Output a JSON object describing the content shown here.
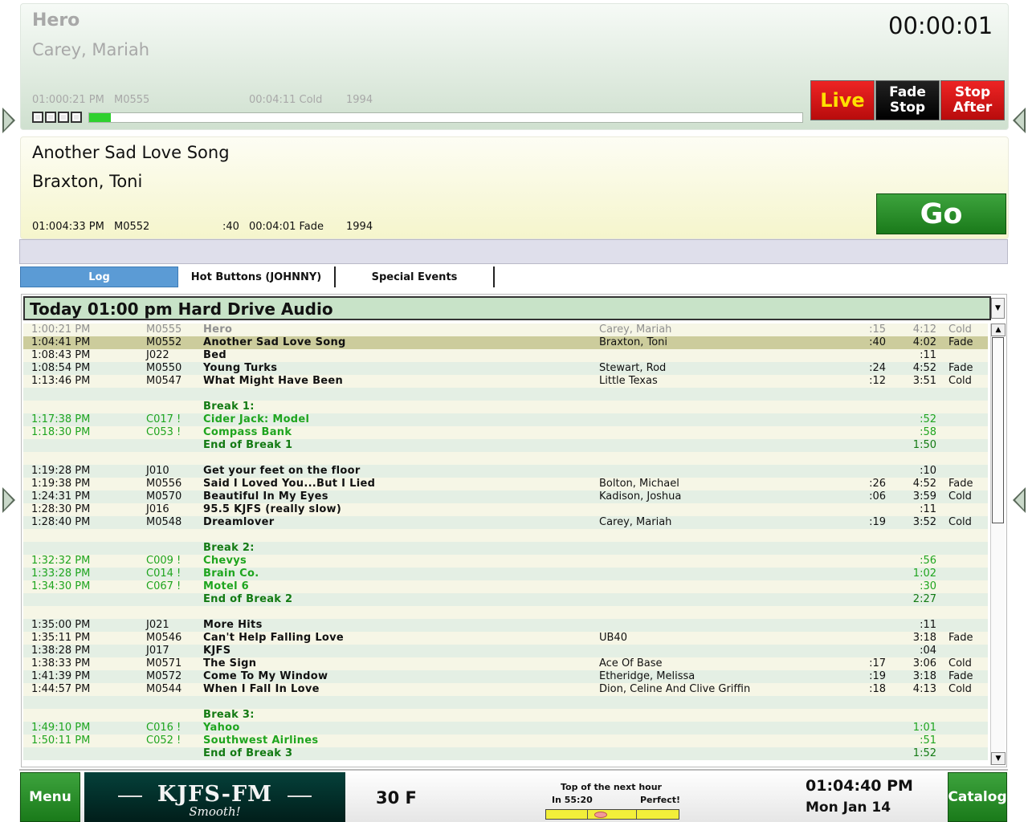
{
  "playing": {
    "title": "Hero",
    "artist": "Carey, Mariah",
    "start_time": "01:000:21 PM",
    "cart_id": "M0555",
    "length_outro": "00:04:11 Cold",
    "year": "1994",
    "progress_fraction": 0.03,
    "timer": "00:00:01"
  },
  "buttons": {
    "live": "Live",
    "fade_stop_1": "Fade",
    "fade_stop_2": "Stop",
    "stop_after_1": "Stop",
    "stop_after_2": "After",
    "go": "Go",
    "menu": "Menu",
    "catalog": "Catalog"
  },
  "next": {
    "title": "Another Sad Love Song",
    "artist": "Braxton, Toni",
    "start_time": "01:004:33 PM",
    "cart_id": "M0552",
    "intro": ":40",
    "length_outro": "00:04:01 Fade",
    "year": "1994"
  },
  "tabs": [
    "Log",
    "Hot Buttons (JOHNNY)",
    "Special Events"
  ],
  "log": {
    "header": "Today 01:00 pm Hard Drive Audio",
    "rows": [
      {
        "type": "played",
        "time": "1:00:21 PM",
        "id": "M0555",
        "title": "Hero",
        "artist": "Carey, Mariah",
        "intro": ":15",
        "len": "4:12",
        "end": "Cold"
      },
      {
        "type": "current",
        "time": "1:04:41 PM",
        "id": "M0552",
        "title": "Another Sad Love Song",
        "artist": "Braxton, Toni",
        "intro": ":40",
        "len": "4:02",
        "end": "Fade"
      },
      {
        "type": "song",
        "time": "1:08:43 PM",
        "id": "J022",
        "title": "Bed",
        "artist": "",
        "intro": "",
        "len": ":11",
        "end": ""
      },
      {
        "type": "song",
        "time": "1:08:54 PM",
        "id": "M0550",
        "title": "Young Turks",
        "artist": "Stewart, Rod",
        "intro": ":24",
        "len": "4:52",
        "end": "Fade"
      },
      {
        "type": "song",
        "time": "1:13:46 PM",
        "id": "M0547",
        "title": "What Might Have Been",
        "artist": "Little Texas",
        "intro": ":12",
        "len": "3:51",
        "end": "Cold"
      },
      {
        "type": "blank",
        "time": "",
        "id": "",
        "title": "",
        "artist": "",
        "intro": "",
        "len": "",
        "end": ""
      },
      {
        "type": "brk",
        "time": "",
        "id": "",
        "title": "Break 1:",
        "artist": "",
        "intro": "",
        "len": "",
        "end": ""
      },
      {
        "type": "spot",
        "time": "1:17:38 PM",
        "id": "C017 !",
        "title": "Cider Jack: Model",
        "artist": "",
        "intro": "",
        "len": ":52",
        "end": ""
      },
      {
        "type": "spot",
        "time": "1:18:30 PM",
        "id": "C053 !",
        "title": "Compass Bank",
        "artist": "",
        "intro": "",
        "len": ":58",
        "end": ""
      },
      {
        "type": "brk",
        "time": "",
        "id": "",
        "title": "End of Break 1",
        "artist": "",
        "intro": "",
        "len": "1:50",
        "end": ""
      },
      {
        "type": "blank",
        "time": "",
        "id": "",
        "title": "",
        "artist": "",
        "intro": "",
        "len": "",
        "end": ""
      },
      {
        "type": "song",
        "time": "1:19:28 PM",
        "id": "J010",
        "title": "Get your feet on the floor",
        "artist": "",
        "intro": "",
        "len": ":10",
        "end": ""
      },
      {
        "type": "song",
        "time": "1:19:38 PM",
        "id": "M0556",
        "title": "Said I Loved You...But I Lied",
        "artist": "Bolton, Michael",
        "intro": ":26",
        "len": "4:52",
        "end": "Fade"
      },
      {
        "type": "song",
        "time": "1:24:31 PM",
        "id": "M0570",
        "title": "Beautiful In My Eyes",
        "artist": "Kadison, Joshua",
        "intro": ":06",
        "len": "3:59",
        "end": "Cold"
      },
      {
        "type": "song",
        "time": "1:28:30 PM",
        "id": "J016",
        "title": "95.5 KJFS (really slow)",
        "artist": "",
        "intro": "",
        "len": ":11",
        "end": ""
      },
      {
        "type": "song",
        "time": "1:28:40 PM",
        "id": "M0548",
        "title": "Dreamlover",
        "artist": "Carey, Mariah",
        "intro": ":19",
        "len": "3:52",
        "end": "Cold"
      },
      {
        "type": "blank",
        "time": "",
        "id": "",
        "title": "",
        "artist": "",
        "intro": "",
        "len": "",
        "end": ""
      },
      {
        "type": "brk",
        "time": "",
        "id": "",
        "title": "Break 2:",
        "artist": "",
        "intro": "",
        "len": "",
        "end": ""
      },
      {
        "type": "spot",
        "time": "1:32:32 PM",
        "id": "C009 !",
        "title": "Chevys",
        "artist": "",
        "intro": "",
        "len": ":56",
        "end": ""
      },
      {
        "type": "spot",
        "time": "1:33:28 PM",
        "id": "C014 !",
        "title": "Brain Co.",
        "artist": "",
        "intro": "",
        "len": "1:02",
        "end": ""
      },
      {
        "type": "spot",
        "time": "1:34:30 PM",
        "id": "C067 !",
        "title": "Motel 6",
        "artist": "",
        "intro": "",
        "len": ":30",
        "end": ""
      },
      {
        "type": "brk",
        "time": "",
        "id": "",
        "title": "End of Break 2",
        "artist": "",
        "intro": "",
        "len": "2:27",
        "end": ""
      },
      {
        "type": "blank",
        "time": "",
        "id": "",
        "title": "",
        "artist": "",
        "intro": "",
        "len": "",
        "end": ""
      },
      {
        "type": "song",
        "time": "1:35:00 PM",
        "id": "J021",
        "title": "More Hits",
        "artist": "",
        "intro": "",
        "len": ":11",
        "end": ""
      },
      {
        "type": "song",
        "time": "1:35:11 PM",
        "id": "M0546",
        "title": "Can't Help Falling Love",
        "artist": "UB40",
        "intro": "",
        "len": "3:18",
        "end": "Fade"
      },
      {
        "type": "song",
        "time": "1:38:28 PM",
        "id": "J017",
        "title": "KJFS",
        "artist": "",
        "intro": "",
        "len": ":04",
        "end": ""
      },
      {
        "type": "song",
        "time": "1:38:33 PM",
        "id": "M0571",
        "title": "The Sign",
        "artist": "Ace Of Base",
        "intro": ":17",
        "len": "3:06",
        "end": "Cold"
      },
      {
        "type": "song",
        "time": "1:41:39 PM",
        "id": "M0572",
        "title": "Come To My Window",
        "artist": "Etheridge, Melissa",
        "intro": ":19",
        "len": "3:18",
        "end": "Fade"
      },
      {
        "type": "song",
        "time": "1:44:57 PM",
        "id": "M0544",
        "title": "When I Fall In Love",
        "artist": "Dion, Celine And Clive Griffin",
        "intro": ":18",
        "len": "4:13",
        "end": "Cold"
      },
      {
        "type": "blank",
        "time": "",
        "id": "",
        "title": "",
        "artist": "",
        "intro": "",
        "len": "",
        "end": ""
      },
      {
        "type": "brk",
        "time": "",
        "id": "",
        "title": "Break 3:",
        "artist": "",
        "intro": "",
        "len": "",
        "end": ""
      },
      {
        "type": "spot",
        "time": "1:49:10 PM",
        "id": "C016 !",
        "title": "Yahoo",
        "artist": "",
        "intro": "",
        "len": "1:01",
        "end": ""
      },
      {
        "type": "spot",
        "time": "1:50:11 PM",
        "id": "C052 !",
        "title": "Southwest Airlines",
        "artist": "",
        "intro": "",
        "len": ":51",
        "end": ""
      },
      {
        "type": "brk",
        "time": "",
        "id": "",
        "title": "End of Break 3",
        "artist": "",
        "intro": "",
        "len": "1:52",
        "end": ""
      }
    ]
  },
  "footer": {
    "logo_main": "KJFS-FM",
    "logo_sub": "Smooth!",
    "temperature": "30 F",
    "top_of_hour_label": "Top of the next hour",
    "top_of_hour_in": "In 55:20",
    "top_of_hour_status": "Perfect!",
    "clock": "01:04:40 PM",
    "date": "Mon Jan 14"
  },
  "colors": {
    "played_text": "#909090",
    "spot_text": "#1fa51f",
    "break_text": "#137a13",
    "current_row": "#cccc9c",
    "go_green": "#2a8f2a",
    "live_red": "#d01818"
  }
}
